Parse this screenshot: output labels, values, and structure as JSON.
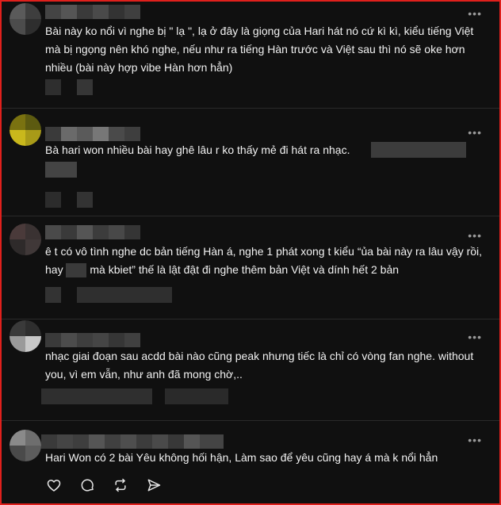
{
  "more_label": "•••",
  "comments": [
    {
      "text": "Bài này ko nổi vì nghe bị \" lạ \", lạ ở đây là giọng của Hari hát nó cứ kì kì, kiểu tiếng Việt mà bị ngọng nên khó nghe, nếu như ra tiếng Hàn trước và Việt sau thì nó sẽ oke hơn nhiều (bài này hợp vibe Hàn hơn hẳn)"
    },
    {
      "text": "Bà hari won nhiều bài hay ghê lâu r ko thấy mẻ đi hát ra nhạc."
    },
    {
      "text_before": "ê t có vô tình nghe dc bản tiếng Hàn á, nghe 1 phát xong t kiểu “ủa bài này ra lâu vậy rồi, hay",
      "text_after": "mà kbiet” thế là lật đật đi nghe thêm bản Việt và dính hết 2 bản"
    },
    {
      "text": "nhạc giai đoạn sau acdd bài nào cũng peak nhưng tiếc là chỉ có vòng fan nghe. without you, vì em vẫn, như anh đã mong chờ,.."
    },
    {
      "text": "Hari Won có 2 bài Yêu không hối hận, Làm sao để yêu cũng hay á mà k nổi hẳn"
    }
  ],
  "actions": {
    "like": "heart-icon",
    "comment": "comment-icon",
    "repost": "repost-icon",
    "share": "share-icon"
  }
}
